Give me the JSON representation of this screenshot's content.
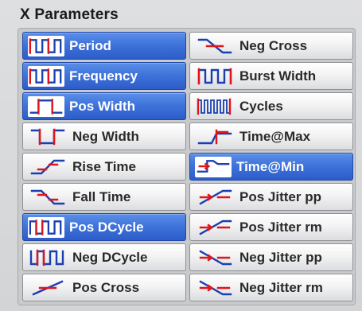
{
  "panel": {
    "title": "X Parameters"
  },
  "buttons": [
    {
      "label": "Period",
      "icon": "period-icon",
      "selected": true
    },
    {
      "label": "Neg Cross",
      "icon": "neg-cross-icon",
      "selected": false
    },
    {
      "label": "Frequency",
      "icon": "frequency-icon",
      "selected": true
    },
    {
      "label": "Burst Width",
      "icon": "burst-width-icon",
      "selected": false
    },
    {
      "label": "Pos Width",
      "icon": "pos-width-icon",
      "selected": true
    },
    {
      "label": "Cycles",
      "icon": "cycles-icon",
      "selected": false
    },
    {
      "label": "Neg Width",
      "icon": "neg-width-icon",
      "selected": false
    },
    {
      "label": "Time@Max",
      "icon": "time-at-max-icon",
      "selected": false
    },
    {
      "label": "Rise Time",
      "icon": "rise-time-icon",
      "selected": false
    },
    {
      "label": "Time@Min",
      "icon": "time-at-min-icon",
      "selected": true
    },
    {
      "label": "Fall Time",
      "icon": "fall-time-icon",
      "selected": false
    },
    {
      "label": "Pos Jitter pp",
      "icon": "pos-jitter-pp-icon",
      "selected": false
    },
    {
      "label": "Pos DCycle",
      "icon": "pos-dcycle-icon",
      "selected": true
    },
    {
      "label": "Pos Jitter rm",
      "icon": "pos-jitter-rm-icon",
      "selected": false
    },
    {
      "label": "Neg DCycle",
      "icon": "neg-dcycle-icon",
      "selected": false
    },
    {
      "label": "Neg Jitter pp",
      "icon": "neg-jitter-pp-icon",
      "selected": false
    },
    {
      "label": "Pos Cross",
      "icon": "pos-cross-icon",
      "selected": false
    },
    {
      "label": "Neg Jitter rm",
      "icon": "neg-jitter-rm-icon",
      "selected": false
    }
  ],
  "colors": {
    "selected": "#3f74db",
    "waveform": "#1a3fb0",
    "marker": "#e0151b"
  }
}
